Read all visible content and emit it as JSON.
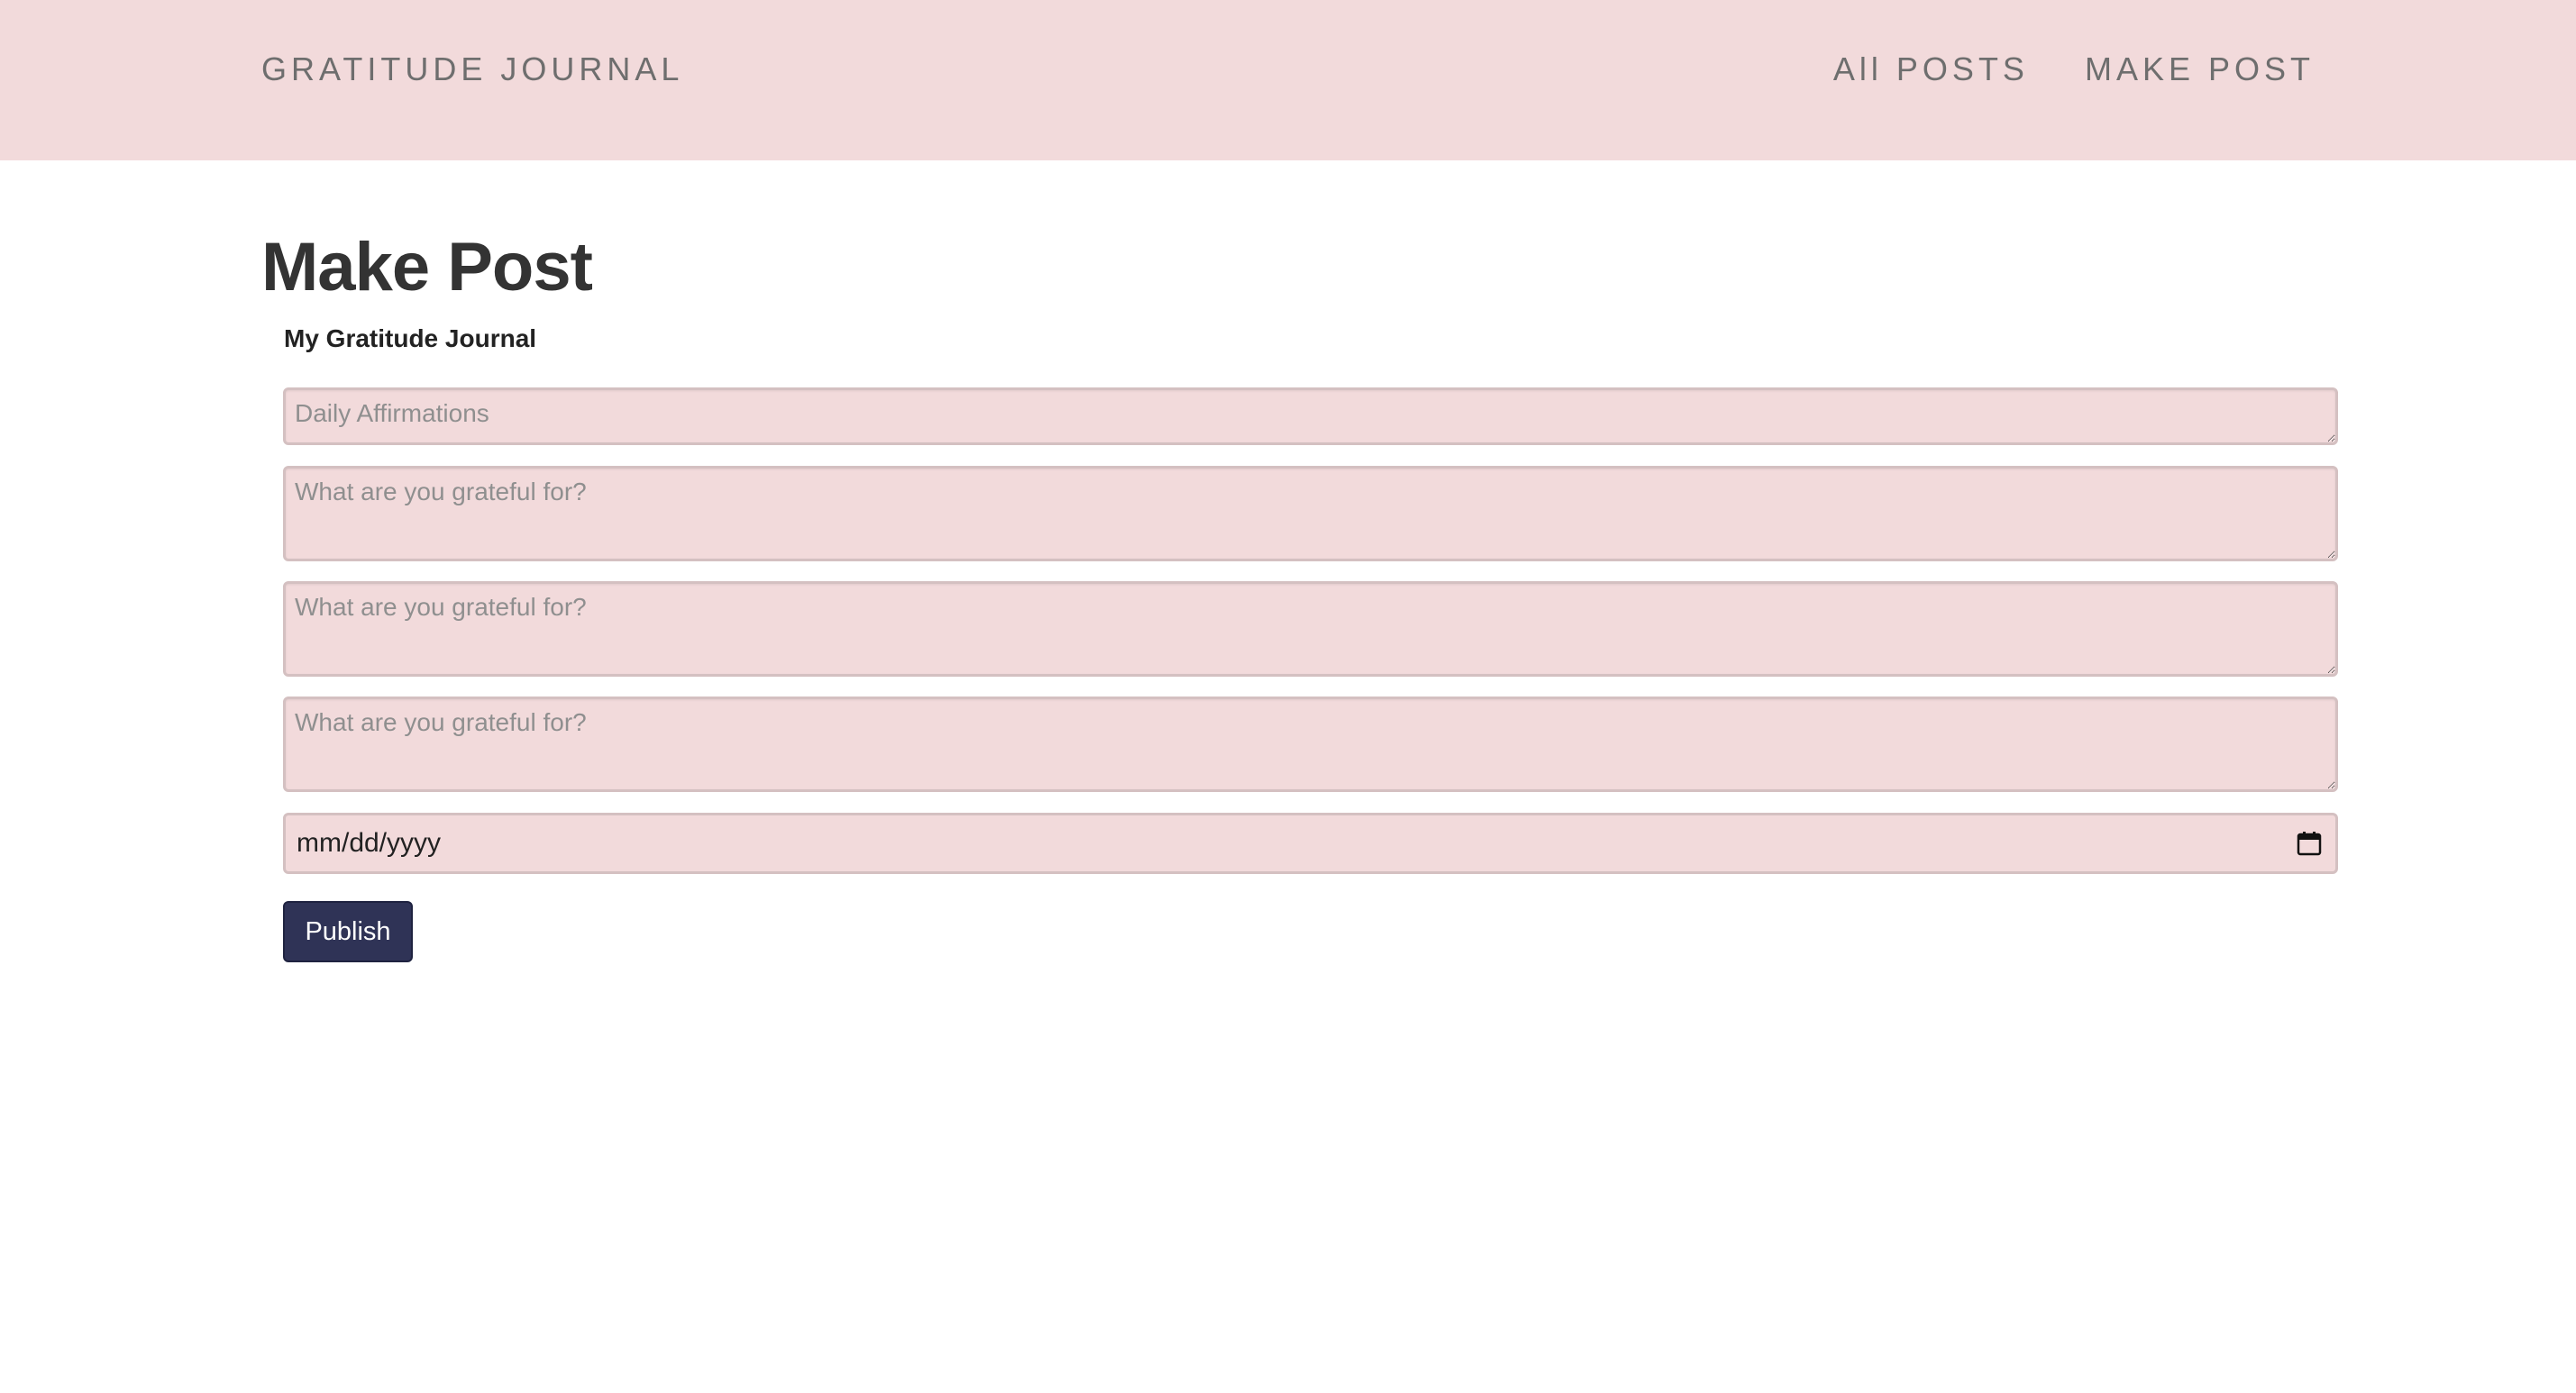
{
  "nav": {
    "brand": "GRATITUDE JOURNAL",
    "links": [
      {
        "label": "All POSTS"
      },
      {
        "label": "MAKE POST"
      }
    ]
  },
  "page": {
    "title": "Make Post"
  },
  "form": {
    "heading": "My Gratitude Journal",
    "title_field": {
      "placeholder": "Daily Affirmations",
      "value": ""
    },
    "gratitude_fields": [
      {
        "placeholder": "What are you grateful for?",
        "value": ""
      },
      {
        "placeholder": "What are you grateful for?",
        "value": ""
      },
      {
        "placeholder": "What are you grateful for?",
        "value": ""
      }
    ],
    "date_field": {
      "placeholder": "mm/dd/yyyy",
      "icon": "calendar-icon"
    },
    "submit_label": "Publish"
  },
  "colors": {
    "navbar_bg": "#f2dadb",
    "field_bg": "#f2dadb",
    "button_bg": "#2f3356",
    "text": "#333333",
    "nav_text": "#6e6e6e"
  }
}
